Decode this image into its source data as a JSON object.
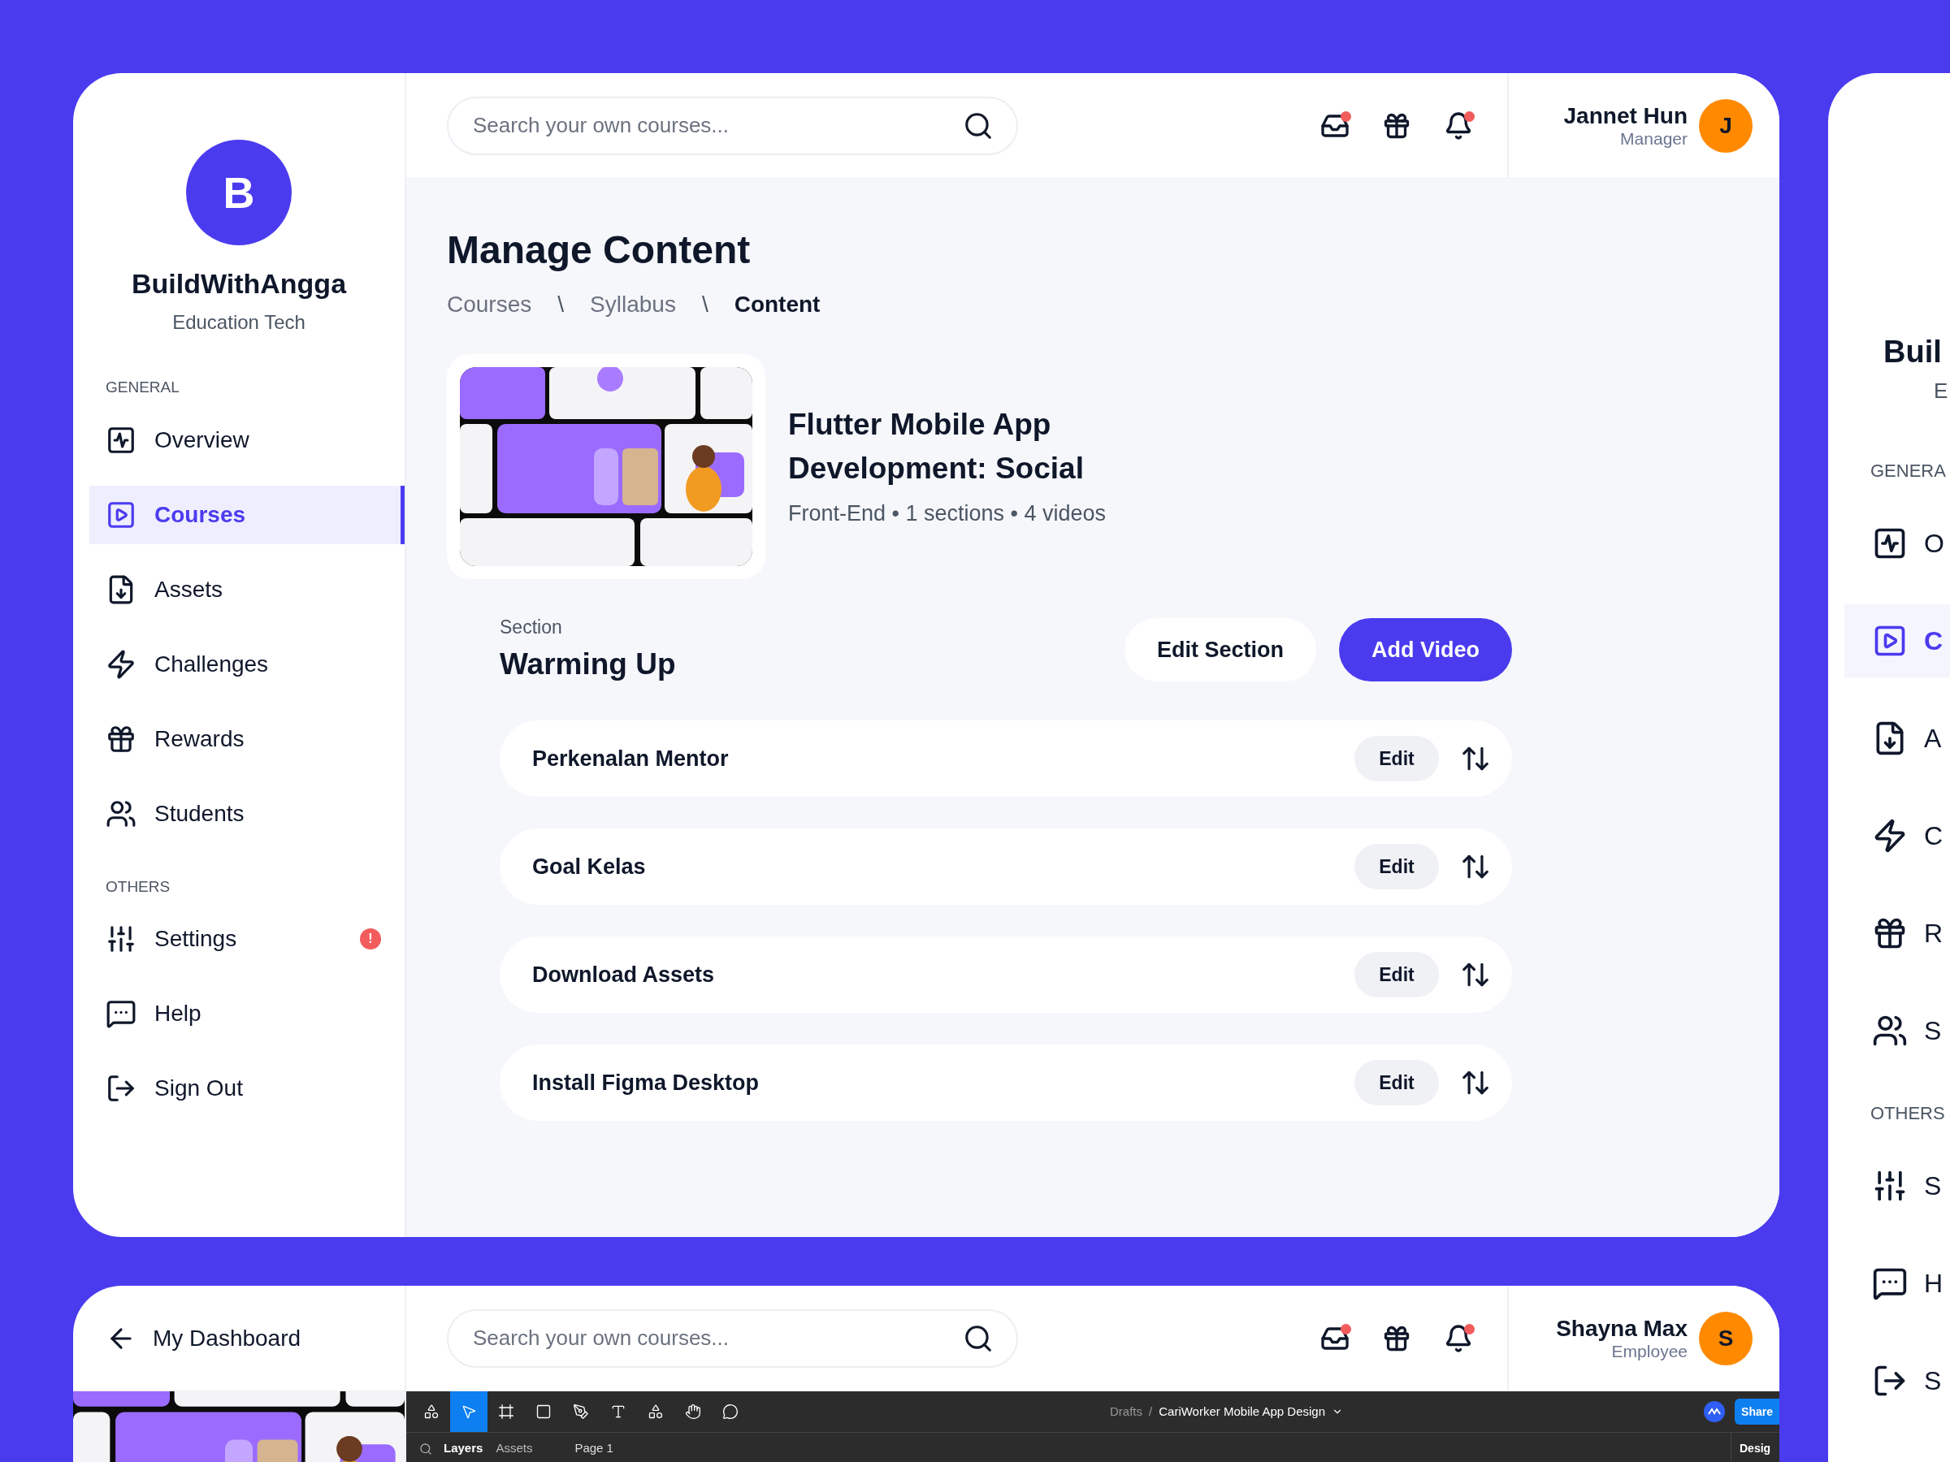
{
  "main_window": {
    "sidebar": {
      "logo_letter": "B",
      "name": "BuildWithAngga",
      "subtitle": "Education Tech",
      "sections": [
        {
          "heading": "GENERAL",
          "items": [
            {
              "label": "Overview",
              "selected": false
            },
            {
              "label": "Courses",
              "selected": true
            },
            {
              "label": "Assets",
              "selected": false
            },
            {
              "label": "Challenges",
              "selected": false
            },
            {
              "label": "Rewards",
              "selected": false
            },
            {
              "label": "Students",
              "selected": false
            }
          ]
        },
        {
          "heading": "OTHERS",
          "items": [
            {
              "label": "Settings",
              "selected": false,
              "badge": "!"
            },
            {
              "label": "Help",
              "selected": false
            },
            {
              "label": "Sign Out",
              "selected": false
            }
          ]
        }
      ]
    },
    "header": {
      "search": {
        "placeholder": "Search your own courses..."
      },
      "notifications": [
        {
          "badge": true
        },
        {
          "badge": false
        },
        {
          "badge": true
        }
      ],
      "user": {
        "name": "Jannet Hun",
        "role": "Manager",
        "initial": "J"
      }
    },
    "content": {
      "title": "Manage Content",
      "breadcrumbs": [
        {
          "label": "Courses",
          "kind": "link",
          "selected": false
        },
        {
          "label": "\\",
          "kind": "separator"
        },
        {
          "label": "Syllabus",
          "kind": "link",
          "selected": false
        },
        {
          "label": "\\",
          "kind": "separator"
        },
        {
          "label": "Content",
          "kind": "link",
          "selected": true
        }
      ],
      "course": {
        "title": "Flutter Mobile App Development: Social",
        "meta": "Front-End • 1 sections • 4 videos"
      },
      "section": {
        "label": "Section",
        "title": "Warming Up",
        "buttons": [
          {
            "label": "Edit Section",
            "kind": "secondary"
          },
          {
            "label": "Add Video",
            "kind": "primary"
          }
        ]
      },
      "lessons": [
        {
          "title": "Perkenalan Mentor",
          "action": "Edit"
        },
        {
          "title": "Goal Kelas",
          "action": "Edit"
        },
        {
          "title": "Download Assets",
          "action": "Edit"
        },
        {
          "title": "Install Figma Desktop",
          "action": "Edit"
        }
      ]
    }
  },
  "bottom_window": {
    "back_link": "My Dashboard",
    "header": {
      "search": {
        "placeholder": "Search your own courses..."
      },
      "notifications": [
        {
          "badge": true
        },
        {
          "badge": false
        },
        {
          "badge": true
        }
      ],
      "user": {
        "name": "Shayna Max",
        "role": "Employee",
        "initial": "S"
      }
    },
    "figma": {
      "tools": [
        {
          "selected": false
        },
        {
          "selected": true
        },
        {
          "selected": false
        },
        {
          "selected": false
        },
        {
          "selected": false
        },
        {
          "selected": false
        },
        {
          "selected": false
        },
        {
          "selected": false
        },
        {
          "selected": false
        }
      ],
      "path": [
        {
          "label": "Drafts",
          "kind": "parent"
        },
        {
          "label": "/",
          "kind": "separator"
        },
        {
          "label": "CariWorker Mobile App Design",
          "kind": "file"
        }
      ],
      "share": "Share",
      "panel_tabs": [
        {
          "label": "Layers",
          "selected": true
        },
        {
          "label": "Assets",
          "selected": false
        }
      ],
      "page": "Page 1",
      "right_panel_tab": "Desig"
    }
  },
  "right_window": {
    "name": "Buil",
    "subtitle": "E",
    "sections": [
      {
        "heading": "GENERA",
        "items": [
          {
            "label": "O",
            "selected": false
          },
          {
            "label": "C",
            "selected": true
          },
          {
            "label": "A",
            "selected": false
          },
          {
            "label": "C",
            "selected": false
          },
          {
            "label": "R",
            "selected": false
          },
          {
            "label": "S",
            "selected": false
          }
        ]
      },
      {
        "heading": "OTHERS",
        "items": [
          {
            "label": "S",
            "selected": false
          },
          {
            "label": "H",
            "selected": false
          },
          {
            "label": "S",
            "selected": false
          }
        ]
      }
    ]
  }
}
